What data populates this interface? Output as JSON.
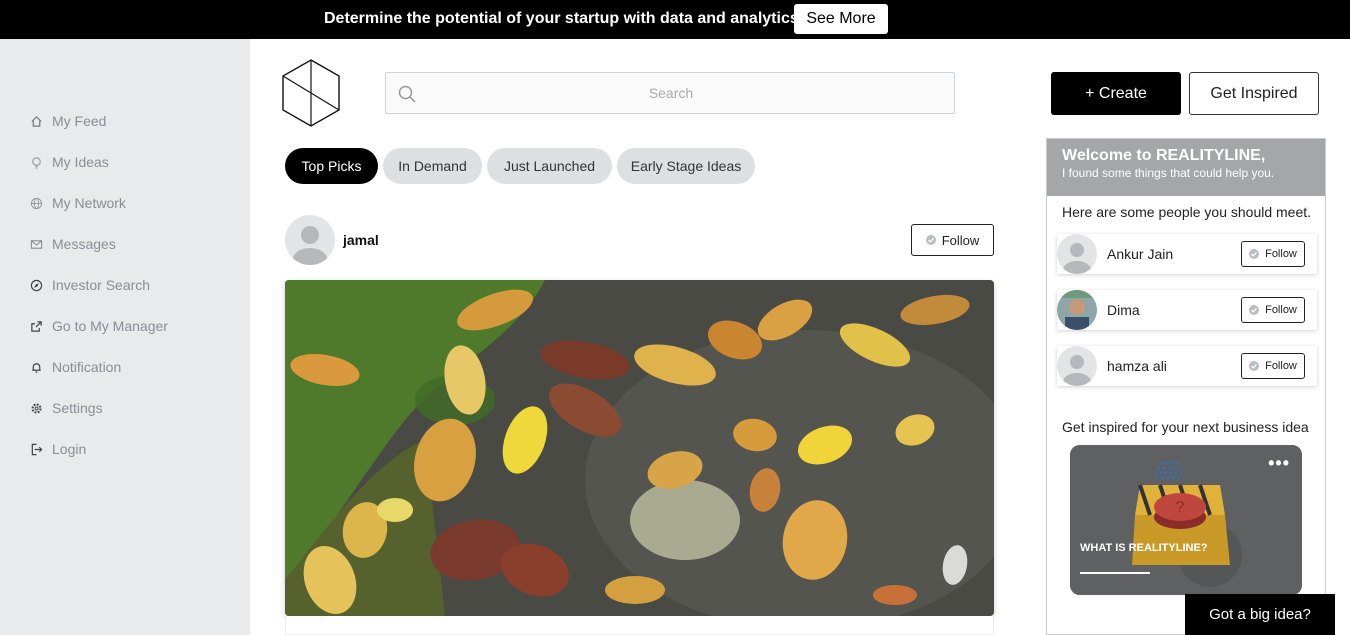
{
  "banner": {
    "text": "Determine the potential of your startup with data and analytics.",
    "button_label": "See More"
  },
  "sidebar": {
    "items": [
      {
        "label": "My Feed",
        "icon": "home-icon"
      },
      {
        "label": "My Ideas",
        "icon": "lightbulb-icon"
      },
      {
        "label": "My Network",
        "icon": "globe-icon"
      },
      {
        "label": "Messages",
        "icon": "envelope-icon"
      },
      {
        "label": "Investor Search",
        "icon": "compass-icon"
      },
      {
        "label": "Go to My Manager",
        "icon": "external-link-icon"
      },
      {
        "label": "Notification",
        "icon": "bell-icon"
      },
      {
        "label": "Settings",
        "icon": "gear-icon"
      },
      {
        "label": "Login",
        "icon": "login-icon"
      }
    ]
  },
  "search": {
    "placeholder": "Search",
    "value": ""
  },
  "header": {
    "create_label": "+ Create",
    "inspired_label": "Get Inspired"
  },
  "tabs": [
    {
      "label": "Top Picks",
      "active": true
    },
    {
      "label": "In Demand",
      "active": false
    },
    {
      "label": "Just Launched",
      "active": false
    },
    {
      "label": "Early Stage Ideas",
      "active": false
    }
  ],
  "post": {
    "author": "jamal",
    "follow_label": "Follow"
  },
  "panel": {
    "title": "Welcome to REALITYLINE,",
    "subtitle": "I found some things that could help you.",
    "people_heading": "Here are some people you should meet.",
    "people": [
      {
        "name": "Ankur Jain",
        "follow_label": "Follow"
      },
      {
        "name": "Dima",
        "follow_label": "Follow"
      },
      {
        "name": "hamza ali",
        "follow_label": "Follow"
      }
    ],
    "inspire_heading": "Get inspired for your next business idea",
    "inspire_card_label": "WHAT IS REALITYLINE?"
  },
  "cta": {
    "big_idea_label": "Got a big idea?"
  },
  "colors": {
    "accent": "#000000",
    "sidebar_bg": "#e9eaec",
    "panel_header_bg": "#a5a6a8"
  }
}
